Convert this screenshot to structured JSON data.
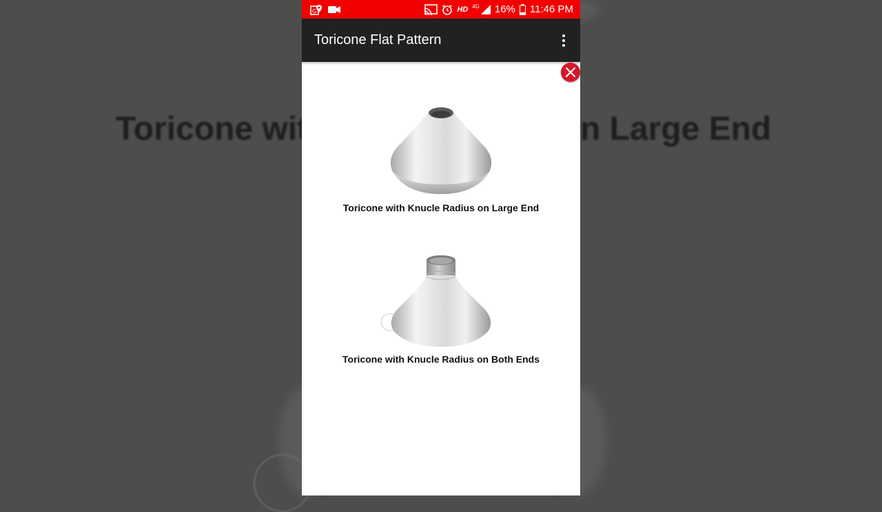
{
  "background": {
    "left_text": "Toricone wit",
    "right_text": "n Large End"
  },
  "status_bar": {
    "battery_percent": "16%",
    "time": "11:46 PM",
    "hd_label": "HD",
    "network_label": "4G",
    "color": "#f20000"
  },
  "app_bar": {
    "title": "Toricone Flat Pattern"
  },
  "options": [
    {
      "label": "Toricone with Knucle Radius on Large End"
    },
    {
      "label": "Toricone with Knucle Radius on Both Ends"
    }
  ],
  "colors": {
    "close_button": "#d2192b",
    "app_bar": "#212121"
  }
}
